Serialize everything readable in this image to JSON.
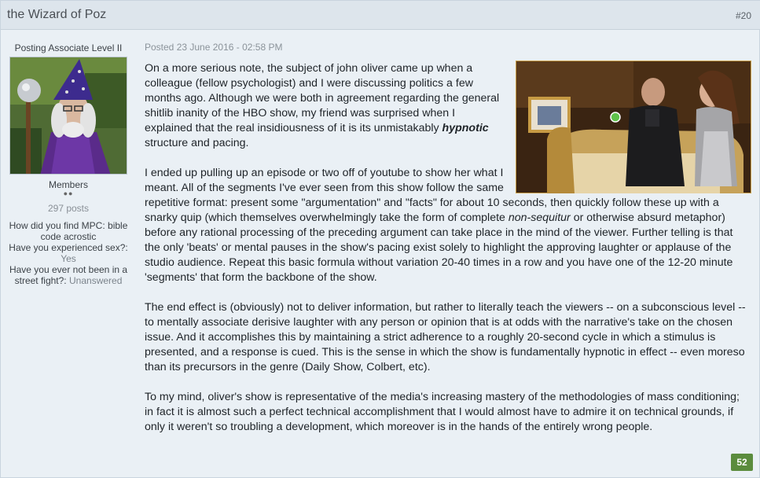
{
  "post": {
    "author": "the Wizard of Poz",
    "number": "#20",
    "date": "Posted 23 June 2016 - 02:58 PM",
    "likes": "52"
  },
  "user": {
    "rank": "Posting Associate Level II",
    "group": "Members",
    "rep_dots": "●●",
    "post_count": "297 posts",
    "fields": [
      {
        "label": "How did you find MPC:",
        "value": "bible code acrostic"
      },
      {
        "label": "Have you experienced sex?:",
        "value": "Yes"
      },
      {
        "label": "Have you ever not been in a street fight?:",
        "value": "Unanswered"
      }
    ]
  },
  "body": {
    "p1_a": "On a more serious note, the subject of john oliver came up when a colleague (fellow psychologist) and I were discussing politics a few months ago. Although we were both in agreement regarding the general shitlib inanity of the HBO show, my friend was surprised when I explained that the real insidiousness of it is its unmistakably ",
    "p1_emph": "hypnotic",
    "p1_b": " structure and pacing.",
    "p2_a": "I ended up pulling up an episode or two off of youtube to show her what I meant. All of the segments I've ever seen from this show follow the same repetitive format: present some \"argumentation\" and \"facts\" for about 10 seconds, then quickly follow these up with a snarky quip (which themselves overwhelmingly take the form of complete ",
    "p2_ital": "non-sequitur",
    "p2_b": " or otherwise absurd metaphor) before any rational processing of the preceding argument can take place in the mind of the viewer. Further telling is that the only 'beats' or mental pauses in the show's pacing exist solely to highlight the approving laughter or applause of the studio audience. Repeat this basic formula without variation 20-40 times in a row and you have one of the 12-20 minute 'segments' that form the backbone of the show.",
    "p3": "The end effect is (obviously) not to deliver information, but rather to literally teach the viewers -- on a subconscious level -- to mentally associate derisive laughter with any person or opinion that is at odds with the narrative's take on the chosen issue. And it accomplishes this by maintaining a strict adherence to a roughly 20-second cycle in which a stimulus is presented, and a response is cued. This is the sense in which the show is fundamentally hypnotic in effect -- even moreso than its precursors in the genre (Daily Show, Colbert, etc).",
    "p4": "To my mind, oliver's show is representative of the media's increasing mastery of the methodologies of mass conditioning; in fact it is almost such a perfect technical accomplishment that I would almost have to admire it on technical grounds, if only it weren't so troubling a development, which moreover is in the hands of the entirely wrong people."
  },
  "colors": {
    "header_bg": "#dde5ec",
    "post_bg": "#eaf0f5",
    "like_badge": "#5b8c3d"
  }
}
